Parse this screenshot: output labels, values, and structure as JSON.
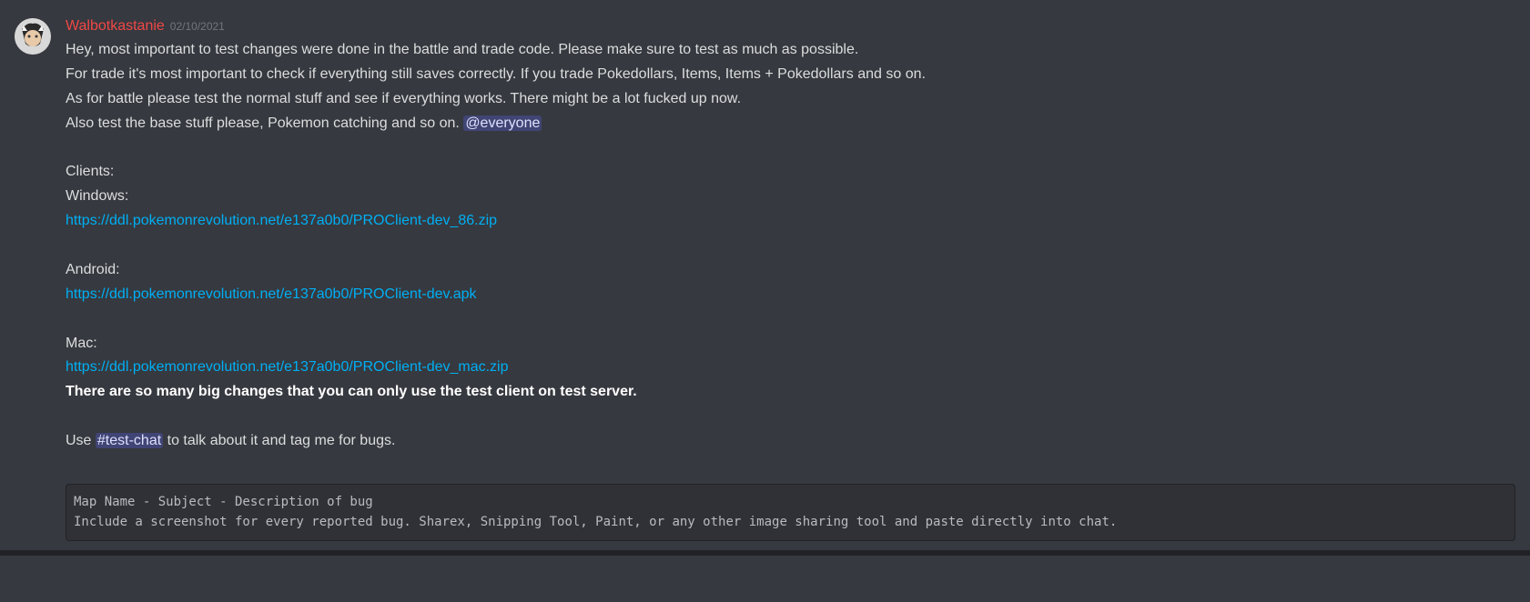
{
  "message": {
    "author": "Walbotkastanie",
    "timestamp": "02/10/2021",
    "lines": {
      "l1": "Hey, most important to test changes were done in the battle and trade code. Please make sure to test as much as possible.",
      "l2": "For trade it's most important to check if everything still saves correctly. If you trade Pokedollars, Items, Items + Pokedollars and so on.",
      "l3": "As for battle please test the normal stuff and see if everything works. There might be a lot fucked up now.",
      "l4_pre": "Also test the base stuff please, Pokemon catching and so on. ",
      "l4_mention": "@everyone",
      "clients_label": "Clients:",
      "windows_label": "Windows:",
      "windows_link": "https://ddl.pokemonrevolution.net/e137a0b0/PROClient-dev_86.zip",
      "android_label": "Android:",
      "android_link": "https://ddl.pokemonrevolution.net/e137a0b0/PROClient-dev.apk",
      "mac_label": "Mac:",
      "mac_link": "https://ddl.pokemonrevolution.net/e137a0b0/PROClient-dev_mac.zip",
      "bold_notice": "There are so many big changes that you can only use the test client on test server.",
      "use_pre": "Use ",
      "channel_mention": "#test-chat",
      "use_post": " to talk about it and tag me for bugs.",
      "code_block": "Map Name - Subject - Description of bug\nInclude a screenshot for every reported bug. Sharex, Snipping Tool, Paint, or any other image sharing tool and paste directly into chat."
    }
  }
}
